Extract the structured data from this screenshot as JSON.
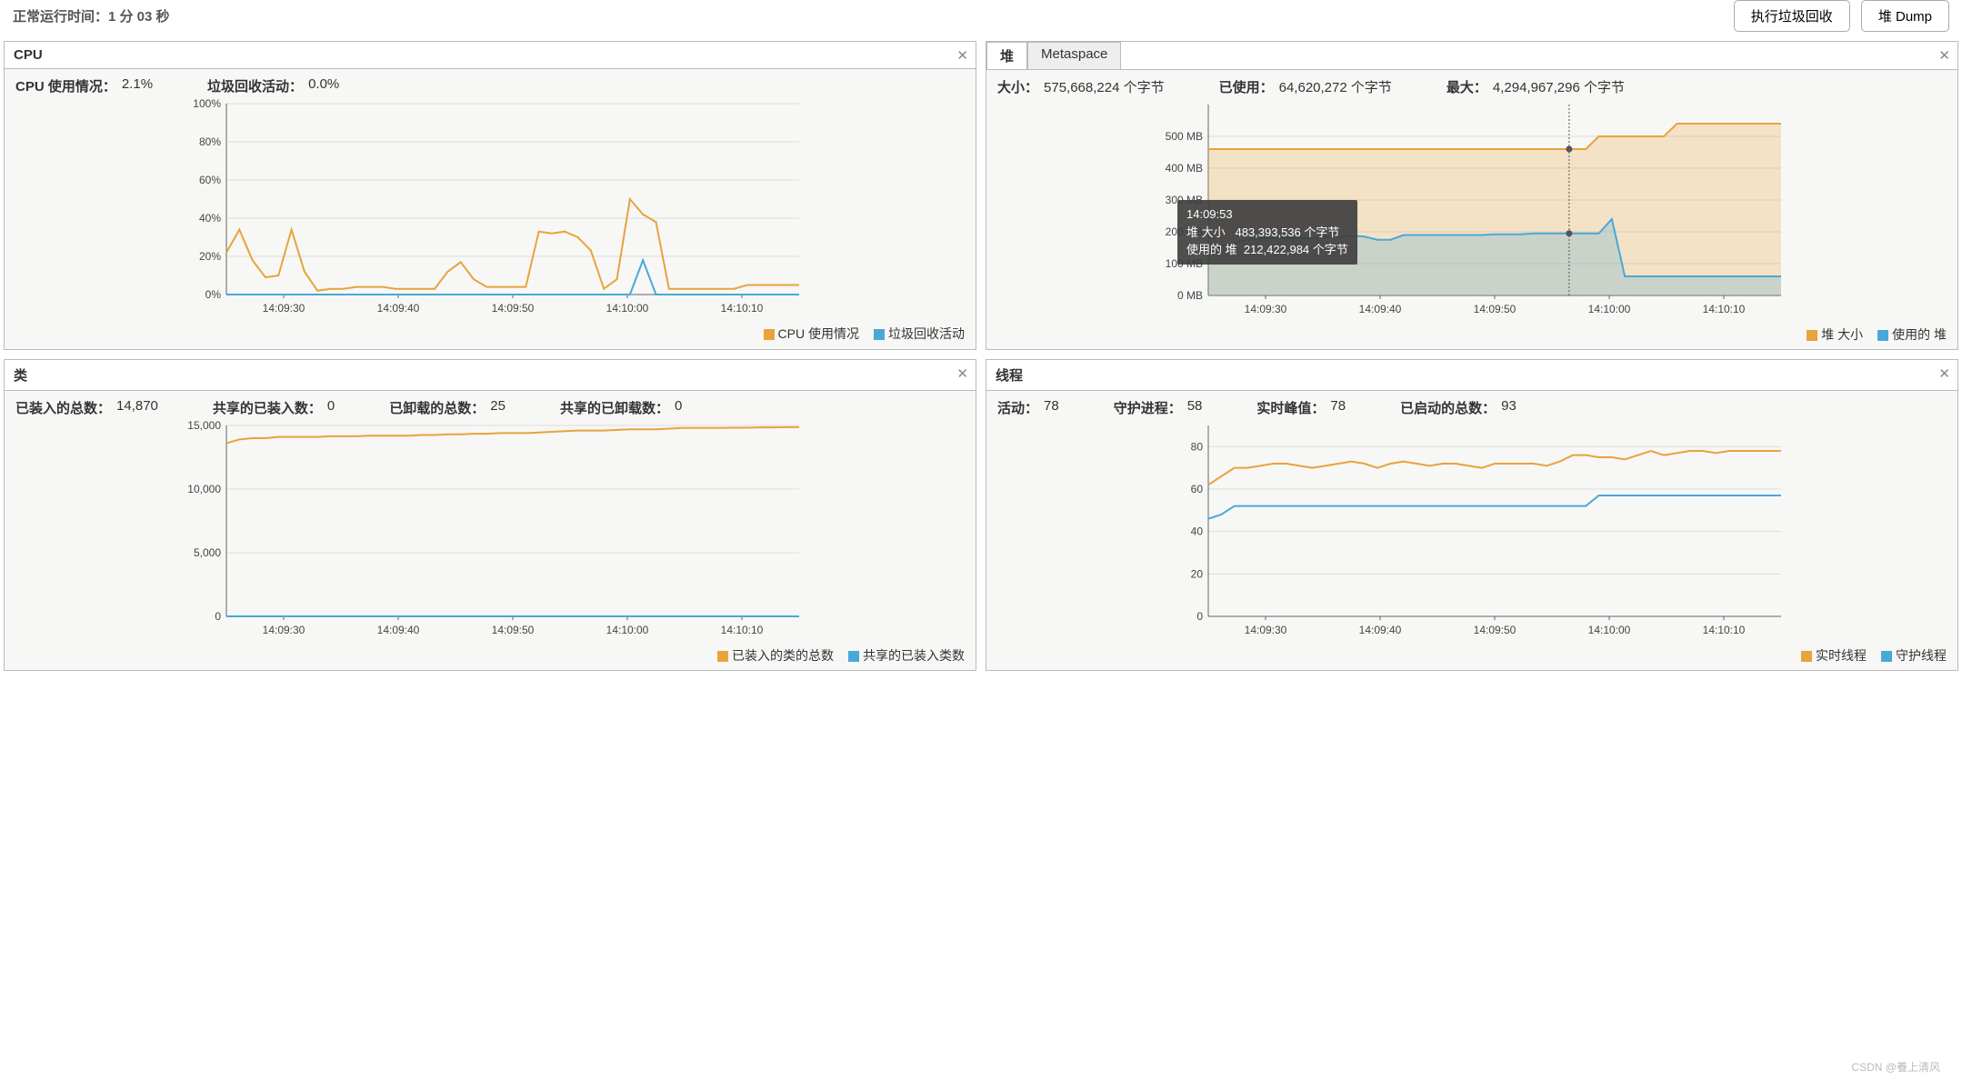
{
  "header": {
    "uptime_label": "正常运行时间：1 分 03 秒",
    "gc_button": "执行垃圾回收",
    "heap_dump_button": "堆 Dump"
  },
  "panels": {
    "cpu": {
      "title": "CPU",
      "stats": {
        "usage_label": "CPU 使用情况：",
        "usage_value": "2.1%",
        "gc_label": "垃圾回收活动：",
        "gc_value": "0.0%"
      },
      "legend": {
        "a": "CPU 使用情况",
        "b": "垃圾回收活动"
      }
    },
    "heap": {
      "tabs": {
        "heap": "堆",
        "metaspace": "Metaspace"
      },
      "stats": {
        "size_label": "大小：",
        "size_value": "575,668,224 个字节",
        "used_label": "已使用：",
        "used_value": "64,620,272 个字节",
        "max_label": "最大：",
        "max_value": "4,294,967,296 个字节"
      },
      "legend": {
        "a": "堆 大小",
        "b": "使用的 堆"
      },
      "tooltip": {
        "time": "14:09:53",
        "row1_label": "堆 大小",
        "row1_value": "483,393,536 个字节",
        "row2_label": "使用的 堆",
        "row2_value": "212,422,984 个字节"
      }
    },
    "classes": {
      "title": "类",
      "stats": {
        "loaded_label": "已装入的总数：",
        "loaded_value": "14,870",
        "shared_loaded_label": "共享的已装入数：",
        "shared_loaded_value": "0",
        "unloaded_label": "已卸载的总数：",
        "unloaded_value": "25",
        "shared_unloaded_label": "共享的已卸载数：",
        "shared_unloaded_value": "0"
      },
      "legend": {
        "a": "已装入的类的总数",
        "b": "共享的已装入类数"
      }
    },
    "threads": {
      "title": "线程",
      "stats": {
        "live_label": "活动：",
        "live_value": "78",
        "daemon_label": "守护进程：",
        "daemon_value": "58",
        "peak_label": "实时峰值：",
        "peak_value": "78",
        "started_label": "已启动的总数：",
        "started_value": "93"
      },
      "legend": {
        "a": "实时线程",
        "b": "守护线程"
      }
    }
  },
  "watermark": "CSDN @養上清风",
  "chart_data": [
    {
      "id": "cpu",
      "type": "line",
      "x_ticks": [
        "14:09:30",
        "14:09:40",
        "14:09:50",
        "14:10:00",
        "14:10:10"
      ],
      "ylim": [
        0,
        100
      ],
      "y_ticks": [
        0,
        20,
        40,
        60,
        80,
        100
      ],
      "y_suffix": "%",
      "series": [
        {
          "name": "CPU 使用情况",
          "color": "#e8a33d",
          "values": [
            22,
            34,
            18,
            9,
            10,
            34,
            12,
            2,
            3,
            3,
            4,
            4,
            4,
            3,
            3,
            3,
            3,
            12,
            17,
            8,
            4,
            4,
            4,
            4,
            33,
            32,
            33,
            30,
            23,
            3,
            8,
            50,
            42,
            38,
            3,
            3,
            3,
            3,
            3,
            3,
            5,
            5,
            5,
            5,
            5
          ]
        },
        {
          "name": "垃圾回收活动",
          "color": "#4aa8d8",
          "values": [
            0,
            0,
            0,
            0,
            0,
            0,
            0,
            0,
            0,
            0,
            0,
            0,
            0,
            0,
            0,
            0,
            0,
            0,
            0,
            0,
            0,
            0,
            0,
            0,
            0,
            0,
            0,
            0,
            0,
            0,
            0,
            0,
            18,
            0,
            0,
            0,
            0,
            0,
            0,
            0,
            0,
            0,
            0,
            0,
            0
          ]
        }
      ]
    },
    {
      "id": "heap",
      "type": "area",
      "x_ticks": [
        "14:09:30",
        "14:09:40",
        "14:09:50",
        "14:10:00",
        "14:10:10"
      ],
      "ylim": [
        0,
        600
      ],
      "y_ticks": [
        0,
        100,
        200,
        300,
        400,
        500
      ],
      "y_suffix": " MB",
      "crosshair_x_ratio": 0.63,
      "series": [
        {
          "name": "堆 大小",
          "color": "#e8a33d",
          "fill": true,
          "values": [
            460,
            460,
            460,
            460,
            460,
            460,
            460,
            460,
            460,
            460,
            460,
            460,
            460,
            460,
            460,
            460,
            460,
            460,
            460,
            460,
            460,
            460,
            460,
            460,
            460,
            460,
            460,
            460,
            460,
            460,
            500,
            500,
            500,
            500,
            500,
            500,
            540,
            540,
            540,
            540,
            540,
            540,
            540,
            540,
            540
          ]
        },
        {
          "name": "使用的 堆",
          "color": "#4aa8d8",
          "fill": true,
          "values": [
            140,
            155,
            165,
            175,
            180,
            180,
            180,
            180,
            180,
            185,
            185,
            188,
            185,
            175,
            175,
            190,
            190,
            190,
            190,
            190,
            190,
            190,
            192,
            192,
            192,
            195,
            195,
            195,
            195,
            195,
            195,
            240,
            60,
            60,
            60,
            60,
            60,
            60,
            60,
            60,
            60,
            60,
            60,
            60,
            60
          ]
        }
      ]
    },
    {
      "id": "classes",
      "type": "line",
      "x_ticks": [
        "14:09:30",
        "14:09:40",
        "14:09:50",
        "14:10:00",
        "14:10:10"
      ],
      "ylim": [
        0,
        15000
      ],
      "y_ticks": [
        0,
        5000,
        10000,
        15000
      ],
      "y_format": "comma",
      "series": [
        {
          "name": "已装入的类的总数",
          "color": "#e8a33d",
          "values": [
            13600,
            13900,
            14000,
            14000,
            14100,
            14100,
            14100,
            14100,
            14150,
            14150,
            14150,
            14200,
            14200,
            14200,
            14200,
            14250,
            14250,
            14300,
            14300,
            14350,
            14350,
            14400,
            14400,
            14400,
            14450,
            14500,
            14550,
            14600,
            14600,
            14600,
            14650,
            14700,
            14700,
            14700,
            14750,
            14800,
            14800,
            14800,
            14800,
            14820,
            14820,
            14850,
            14850,
            14870,
            14870
          ]
        },
        {
          "name": "共享的已装入类数",
          "color": "#4aa8d8",
          "values": [
            0,
            0,
            0,
            0,
            0,
            0,
            0,
            0,
            0,
            0,
            0,
            0,
            0,
            0,
            0,
            0,
            0,
            0,
            0,
            0,
            0,
            0,
            0,
            0,
            0,
            0,
            0,
            0,
            0,
            0,
            0,
            0,
            0,
            0,
            0,
            0,
            0,
            0,
            0,
            0,
            0,
            0,
            0,
            0,
            0
          ]
        }
      ]
    },
    {
      "id": "threads",
      "type": "line",
      "x_ticks": [
        "14:09:30",
        "14:09:40",
        "14:09:50",
        "14:10:00",
        "14:10:10"
      ],
      "ylim": [
        0,
        90
      ],
      "y_ticks": [
        0,
        20,
        40,
        60,
        80
      ],
      "series": [
        {
          "name": "实时线程",
          "color": "#e8a33d",
          "values": [
            62,
            66,
            70,
            70,
            71,
            72,
            72,
            71,
            70,
            71,
            72,
            73,
            72,
            70,
            72,
            73,
            72,
            71,
            72,
            72,
            71,
            70,
            72,
            72,
            72,
            72,
            71,
            73,
            76,
            76,
            75,
            75,
            74,
            76,
            78,
            76,
            77,
            78,
            78,
            77,
            78,
            78,
            78,
            78,
            78
          ]
        },
        {
          "name": "守护线程",
          "color": "#4aa8d8",
          "values": [
            46,
            48,
            52,
            52,
            52,
            52,
            52,
            52,
            52,
            52,
            52,
            52,
            52,
            52,
            52,
            52,
            52,
            52,
            52,
            52,
            52,
            52,
            52,
            52,
            52,
            52,
            52,
            52,
            52,
            52,
            57,
            57,
            57,
            57,
            57,
            57,
            57,
            57,
            57,
            57,
            57,
            57,
            57,
            57,
            57
          ]
        }
      ]
    }
  ]
}
